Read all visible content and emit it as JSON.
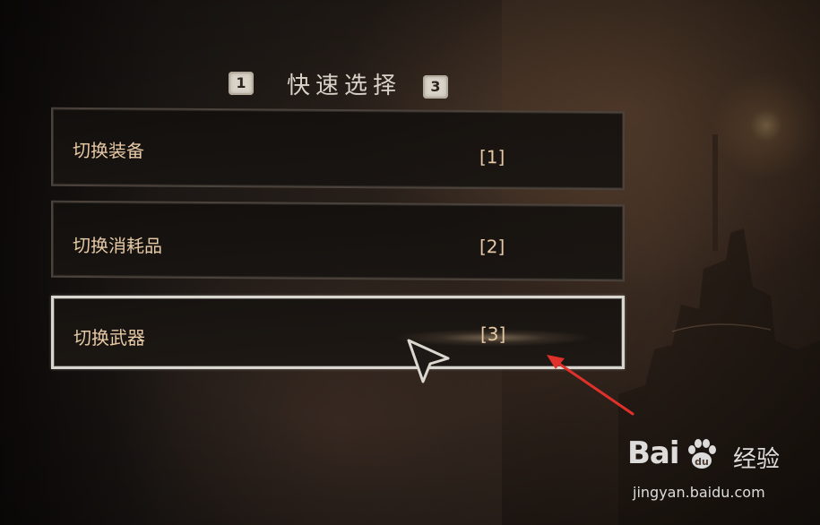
{
  "header": {
    "key_left": "1",
    "title": "快速选择",
    "key_right": "3"
  },
  "options": [
    {
      "label": "切换装备",
      "key": "[1]",
      "selected": false
    },
    {
      "label": "切换消耗品",
      "key": "[2]",
      "selected": false
    },
    {
      "label": "切换武器",
      "key": "[3]",
      "selected": true
    }
  ],
  "colors": {
    "option_text": "#e6c9a5",
    "title_text": "#d8d2c8",
    "selected_border": "#d9d6d0",
    "annotation_arrow": "#e0302a"
  },
  "icons": {
    "cursor": "pointer-cursor-icon",
    "annotation": "red-arrow-icon",
    "watermark_paw": "baidu-paw-icon"
  },
  "watermark": {
    "logo_left": "Bai",
    "logo_right": "经验",
    "url": "jingyan.baidu.com"
  }
}
